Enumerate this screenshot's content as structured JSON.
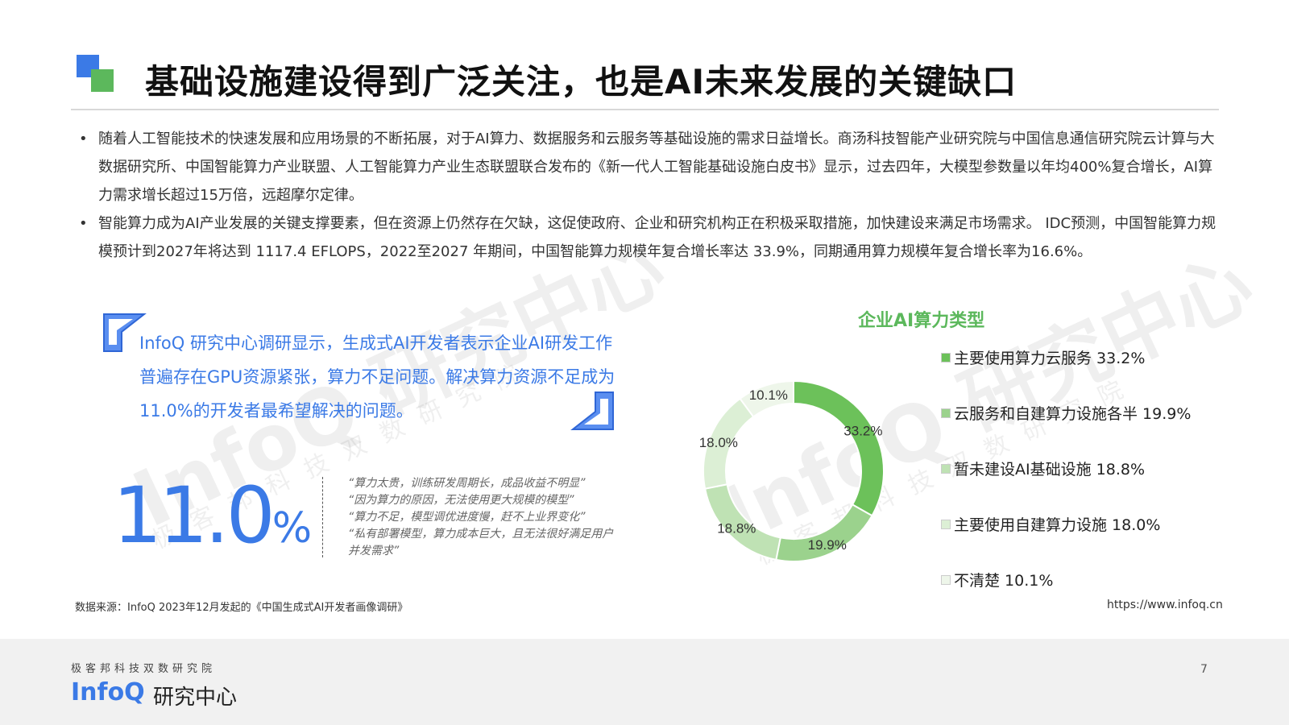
{
  "header": {
    "title": "基础设施建设得到广泛关注，也是AI未来发展的关键缺口"
  },
  "bullets": [
    "随着人工智能技术的快速发展和应用场景的不断拓展，对于AI算力、数据服务和云服务等基础设施的需求日益增长。商汤科技智能产业研究院与中国信息通信研究院云计算与大数据研究所、中国智能算力产业联盟、人工智能算力产业生态联盟联合发布的《新一代人工智能基础设施白皮书》显示，过去四年，大模型参数量以年均400%复合增长，AI算力需求增长超过15万倍，远超摩尔定律。",
    "智能算力成为AI产业发展的关键支撑要素，但在资源上仍然存在欠缺，这促使政府、企业和研究机构正在积极采取措施，加快建设来满足市场需求。 IDC预测，中国智能算力规模预计到2027年将达到 1117.4 EFLOPS，2022至2027 年期间，中国智能算力规模年复合增长率达 33.9%，同期通用算力规模年复合增长率为16.6%。"
  ],
  "callout": {
    "text": "InfoQ 研究中心调研显示，生成式AI开发者表示企业AI研发工作普遍存在GPU资源紧张，算力不足问题。解决算力资源不足成为11.0%的开发者最希望解决的问题。",
    "big_number": "11.0",
    "big_unit": "%",
    "quotes": [
      "“算力太贵，训练研发周期长，成品收益不明显”",
      "“因为算力的原因，无法使用更大规模的模型”",
      "“算力不足，模型调优进度慢，赶不上业界变化”",
      "“私有部署模型，算力成本巨大，且无法很好满足用户并发需求”"
    ]
  },
  "source": "数据来源：InfoQ 2023年12月发起的《中国生成式AI开发者画像调研》",
  "url": "https://www.infoq.cn",
  "watermark": {
    "main": "InfoQ 研究中心",
    "sub": "极客邦科技双数研究院"
  },
  "footer": {
    "tagline": "极客邦科技双数研究院",
    "brand": "InfoQ",
    "brand_suffix": "研究中心",
    "page": "7"
  },
  "colors": {
    "accent_blue": "#3b7ae6",
    "accent_green": "#5cb85c"
  },
  "chart_data": {
    "type": "pie",
    "title": "企业AI算力类型",
    "donut": true,
    "legend_position": "right",
    "slices": [
      {
        "label": "主要使用算力云服务",
        "value": 33.2,
        "value_label": "33.2%",
        "color": "#6cc15a"
      },
      {
        "label": "云服务和自建算力设施各半",
        "value": 19.9,
        "value_label": "19.9%",
        "color": "#9bd28d"
      },
      {
        "label": "暂未建设AI基础设施",
        "value": 18.8,
        "value_label": "18.8%",
        "color": "#bfe2b4"
      },
      {
        "label": "主要使用自建算力设施",
        "value": 18.0,
        "value_label": "18.0%",
        "color": "#dcefd5"
      },
      {
        "label": "不清楚",
        "value": 10.1,
        "value_label": "10.1%",
        "color": "#eef6ea"
      }
    ]
  }
}
